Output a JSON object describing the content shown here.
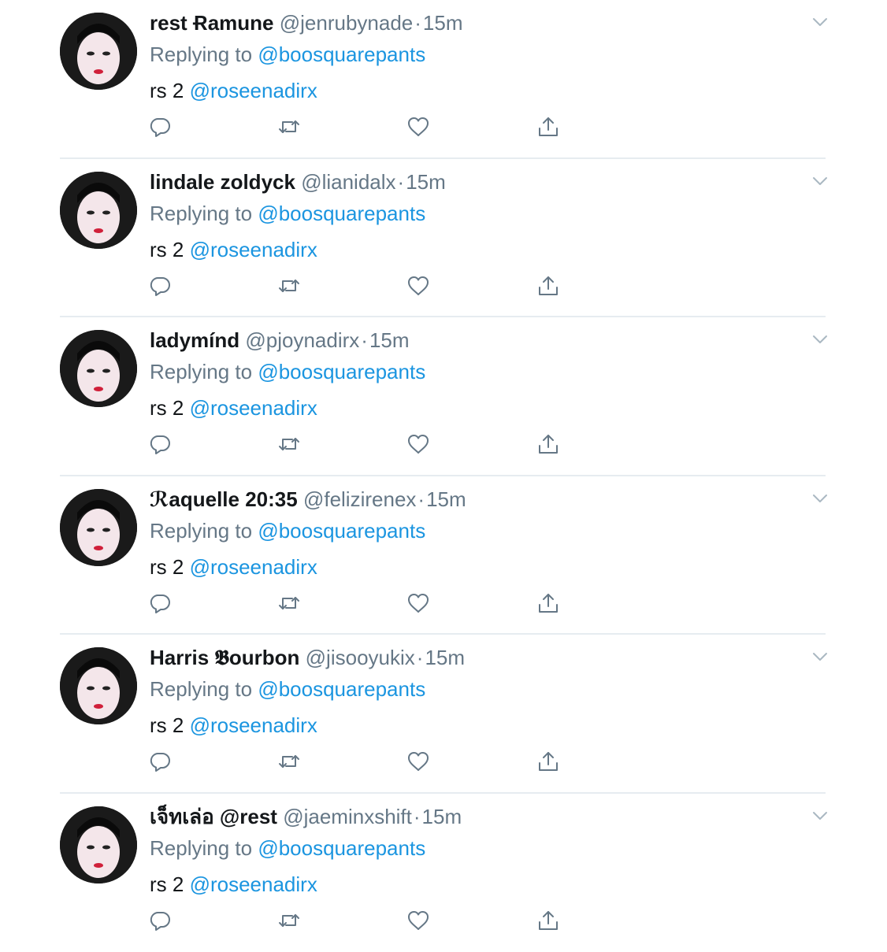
{
  "reply_prefix": "Replying to",
  "replying_to": "@boosquarepants",
  "body_text": "rs 2",
  "body_mention": "@roseenadirx",
  "separator": "·",
  "colors": {
    "name": "#14171a",
    "muted": "#657786",
    "link": "#1b95e0",
    "divider": "#e6ecf0"
  },
  "icons": {
    "reply": "reply-icon",
    "retweet": "retweet-icon",
    "like": "heart-icon",
    "share": "share-icon",
    "menu": "chevron-down-icon"
  },
  "tweets": [
    {
      "name": "rest Ɍamune",
      "handle": "@jenrubynade",
      "time": "15m"
    },
    {
      "name": "lindale zoldyck",
      "handle": "@lianidalx",
      "time": "15m"
    },
    {
      "name": "ladymínd",
      "handle": "@pjoynadirx",
      "time": "15m"
    },
    {
      "name": "ℛaquelle 20:35",
      "handle": "@felizirenex",
      "time": "15m"
    },
    {
      "name": "Harris 𝕭ourbon",
      "handle": "@jisooyukix",
      "time": "15m"
    },
    {
      "name": "เจ็ทเล่อ @rest",
      "handle": "@jaeminxshift",
      "time": "15m"
    }
  ]
}
